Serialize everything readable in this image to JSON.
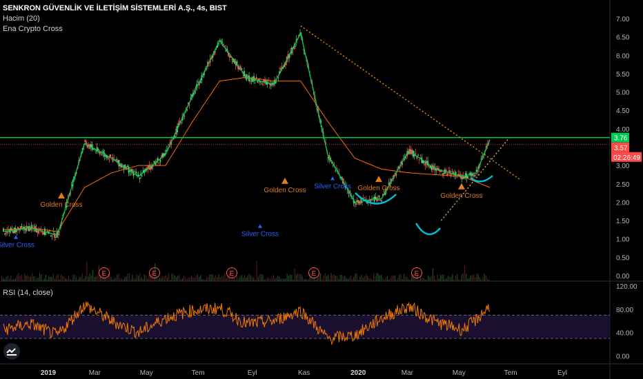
{
  "header": {
    "title": "SENKRON GÜVENLİK VE İLETİŞİM SİSTEMLERİ A.Ş., 4s, BIST",
    "indicator_1": "Hacim (20)",
    "indicator_2": "Ena Crypto Cross"
  },
  "rsi_panel": {
    "label": "RSI (14, close)"
  },
  "colors": {
    "price_line": "#00c853",
    "ma_line": "#ff6d00",
    "candle_up": "#5ad47a",
    "candle_down": "#ff5a5a",
    "resistance": "#00c853",
    "trendline": "#ff9800",
    "arc": "#00bcd4",
    "rsi": "#f57c00",
    "rsi_band": "#1a0f2e",
    "price_tag": "#ff4a4a",
    "last_tag": "#00c853"
  },
  "chart_data": [
    {
      "type": "line",
      "title": "SENKRON GÜVENLİK VE İLETİŞİM SİSTEMLERİ A.Ş., 4s, BIST",
      "x_ticks": [
        "2019",
        "Mar",
        "May",
        "Tem",
        "Eyl",
        "Kas",
        "2020",
        "Mar",
        "May",
        "Tem",
        "Eyl"
      ],
      "y_ticks": [
        "7.00",
        "6.50",
        "6.00",
        "5.50",
        "5.00",
        "4.50",
        "4.00",
        "3.50",
        "3.00",
        "2.50",
        "2.00",
        "1.50",
        "1.00",
        "0.50",
        "0.00"
      ],
      "ylim": [
        0,
        7
      ],
      "x_months_from_start": [
        0,
        1,
        2,
        3,
        4,
        5,
        6,
        7,
        8,
        9,
        10,
        11,
        12,
        13,
        14,
        15,
        16,
        17,
        17.5,
        18
      ],
      "price": [
        1.2,
        1.3,
        1.1,
        3.6,
        3.2,
        2.7,
        3.3,
        4.9,
        6.4,
        5.4,
        5.2,
        6.6,
        3.3,
        2.0,
        2.1,
        3.4,
        2.9,
        2.7,
        2.8,
        3.7
      ],
      "ma": [
        1.25,
        1.3,
        1.2,
        2.4,
        2.8,
        3.0,
        3.0,
        4.2,
        5.3,
        5.4,
        5.3,
        5.3,
        4.2,
        3.2,
        2.9,
        2.8,
        2.75,
        2.7,
        2.55,
        2.4
      ],
      "price_tags": [
        "3.76",
        "3.57"
      ],
      "time_tag": "02:26:49",
      "resistance": 3.76,
      "dotted_level": 3.57,
      "earnings_label": "E",
      "earnings_count": 5,
      "annotations": [
        {
          "label": "Silver Cross",
          "kind": "silver"
        },
        {
          "label": "Golden Cross",
          "kind": "golden"
        },
        {
          "label": "Golden Cross",
          "kind": "golden"
        },
        {
          "label": "Silver Cross",
          "kind": "silver"
        },
        {
          "label": "Silver Cross",
          "kind": "silver"
        },
        {
          "label": "Golden Cross",
          "kind": "golden"
        },
        {
          "label": "Golden Cross",
          "kind": "golden"
        }
      ]
    },
    {
      "type": "line",
      "title": "RSI (14, close)",
      "y_ticks": [
        "120.00",
        "80.00",
        "40.00",
        "0.00"
      ],
      "ylim": [
        -10,
        120
      ],
      "upper_band": 70,
      "lower_band": 30,
      "x_months_from_start": [
        0,
        1,
        2,
        3,
        4,
        5,
        6,
        7,
        8,
        9,
        10,
        11,
        12,
        13,
        14,
        15,
        16,
        17,
        17.5,
        18
      ],
      "values": [
        45,
        55,
        35,
        88,
        60,
        40,
        65,
        78,
        82,
        55,
        60,
        78,
        30,
        35,
        65,
        85,
        58,
        45,
        62,
        86
      ]
    }
  ]
}
